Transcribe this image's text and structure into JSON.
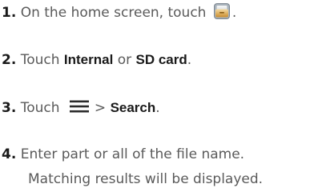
{
  "steps": [
    {
      "number": "1.",
      "text_before": "On the home screen, touch",
      "icon": "file-manager-icon",
      "text_after": "."
    },
    {
      "number": "2.",
      "text_before": "Touch ",
      "bold1": "Internal",
      "middle": " or ",
      "bold2": "SD card",
      "text_after": "."
    },
    {
      "number": "3.",
      "text_before": "Touch",
      "icon": "menu-icon",
      "separator": "> ",
      "bold1": "Search",
      "text_after": "."
    },
    {
      "number": "4.",
      "line1": "Enter part or all of the file name.",
      "line2": "Matching results will be displayed."
    }
  ]
}
